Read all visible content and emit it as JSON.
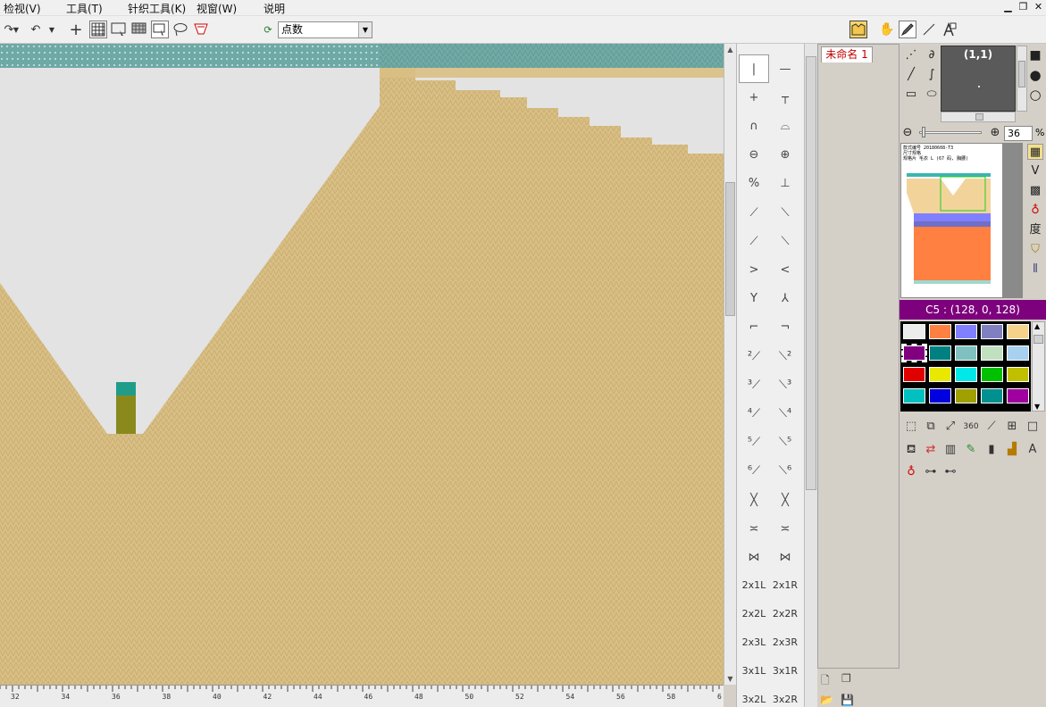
{
  "menu": {
    "items": [
      "检视(V)",
      "工具(T)",
      "针织工具(K)",
      "视窗(W)",
      "说明"
    ]
  },
  "window_controls": {
    "minimize": "▁",
    "restore": "❐",
    "close": "✕"
  },
  "toolbar": {
    "mode_select_value": "点数",
    "icons": [
      "redo-icon",
      "undo-icon",
      "crosshair-icon",
      "grid-icon",
      "select-rect-icon",
      "grid-pattern-icon",
      "select-icon",
      "lasso-icon",
      "magic-select-icon"
    ]
  },
  "canvas": {
    "ruler_labels": [
      "32",
      "34",
      "36",
      "38",
      "40",
      "42",
      "44",
      "46",
      "48",
      "50",
      "52",
      "54",
      "56",
      "58",
      "6"
    ],
    "colors": {
      "knit": "#d9bf84",
      "knit_dark": "#c7ab6c",
      "empty": "#e3e3e3",
      "rib": "#6fa9a6",
      "rib_light": "#b9d9d6",
      "pocket_top": "#1f9c8a",
      "pocket_body": "#8a8a1c"
    }
  },
  "stitch_palette": {
    "symbols": [
      "|",
      "—",
      "+",
      "┬",
      "∩",
      "⌓",
      "⊖",
      "⊕",
      "%",
      "⊥",
      "⟋",
      "⟍",
      "⟋",
      "⟍",
      ">",
      "<",
      "Y",
      "⅄",
      "⌐",
      "¬",
      "²⟋",
      "⟍²",
      "³⟋",
      "⟍³",
      "⁴⟋",
      "⟍⁴",
      "⁵⟋",
      "⟍⁵",
      "⁶⟋",
      "⟍⁶",
      "╳",
      "╳",
      "≍",
      "≍",
      "⋈",
      "⋈"
    ],
    "text_buttons": [
      "2x1L",
      "2x1R",
      "2x2L",
      "2x2R",
      "2x3L",
      "2x3R",
      "3x1L",
      "3x1R",
      "3x2L",
      "3x2R"
    ]
  },
  "file_panel": {
    "tab_label": "未命名 1"
  },
  "right_panel": {
    "preview_coords": "(1,1)",
    "zoom_value": "36",
    "zoom_unit": "%",
    "degree_label": "度",
    "thumbnail_header_lines": [
      "款式编号  20180608-T3",
      "尺寸规格",
      "规格片  毛衣 L (67 码, 胸腰)"
    ],
    "color_label": "C5 : (128, 0, 128)",
    "swatches": [
      "#ececec",
      "#ff8040",
      "#8080ff",
      "#8080c0",
      "#f5d28c",
      "#800080",
      "#008080",
      "#80c0c0",
      "#c0e0c0",
      "#a8d0f0",
      "#e00000",
      "#e8e800",
      "#00e8e8",
      "#00c000",
      "#c0c000",
      "#00c0c0",
      "#0000e0",
      "#a0a000",
      "#009090",
      "#a000a0"
    ],
    "thumbnail_colors": {
      "rib": "#3cb5b0",
      "body": "#f2d49b",
      "band1": "#8080ff",
      "band2": "#6f6fc8",
      "orange": "#ff8040",
      "bottom_rib": "#9fd8d0"
    }
  }
}
